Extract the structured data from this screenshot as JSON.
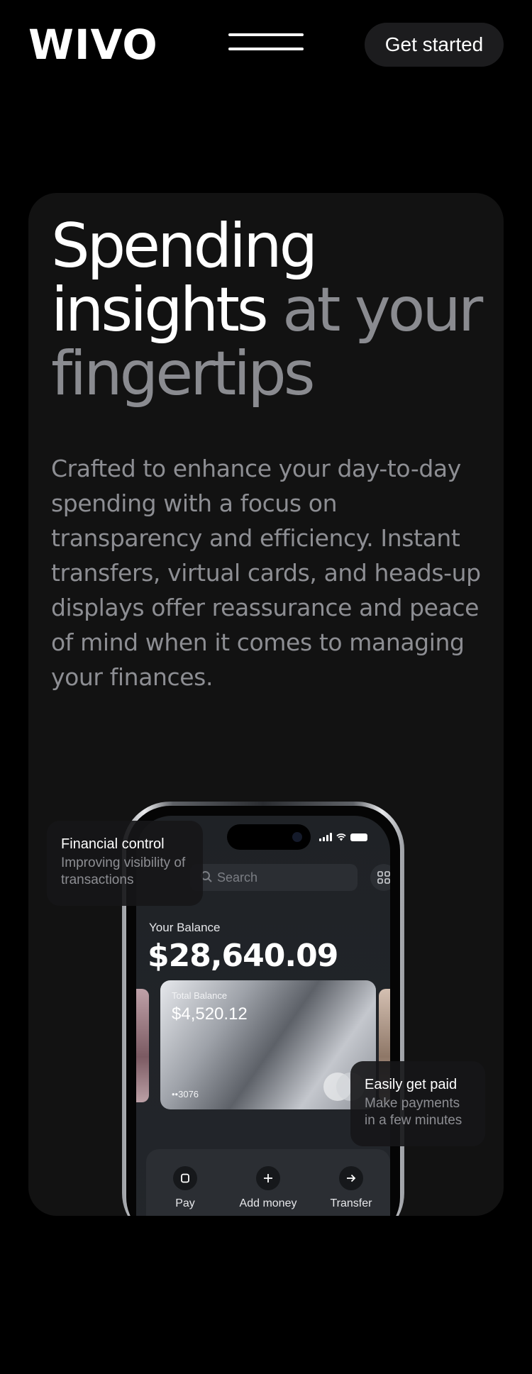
{
  "header": {
    "logo": "WIVO",
    "menu_icon": "hamburger-menu-icon",
    "cta_label": "Get started"
  },
  "hero": {
    "headline_white": "Spending insights",
    "headline_dim": "at your fingertips",
    "description": "Crafted to enhance your day-to-day spending with a focus on transparency and efficiency. Instant transfers, virtual cards, and heads-up displays offer reassurance and peace of mind when it comes to managing your finances."
  },
  "phone": {
    "search_placeholder": "Search",
    "balance_label": "Your Balance",
    "balance_amount": "$28,640.09",
    "card": {
      "label": "Total Balance",
      "amount": "$4,520.12",
      "number": "••3076"
    },
    "actions": [
      {
        "label": "Pay",
        "icon": "card-icon"
      },
      {
        "label": "Add money",
        "icon": "plus-icon"
      },
      {
        "label": "Transfer",
        "icon": "arrow-right-icon"
      }
    ]
  },
  "callouts": {
    "financial_control": {
      "title": "Financial control",
      "subtitle": "Improving visibility of transactions"
    },
    "get_paid": {
      "title": "Easily get paid",
      "subtitle": "Make payments in a few minutes"
    }
  },
  "colors": {
    "background": "#000000",
    "card_background": "#121212",
    "muted_text": "#8a8b90",
    "button_background": "#1c1c1e"
  }
}
